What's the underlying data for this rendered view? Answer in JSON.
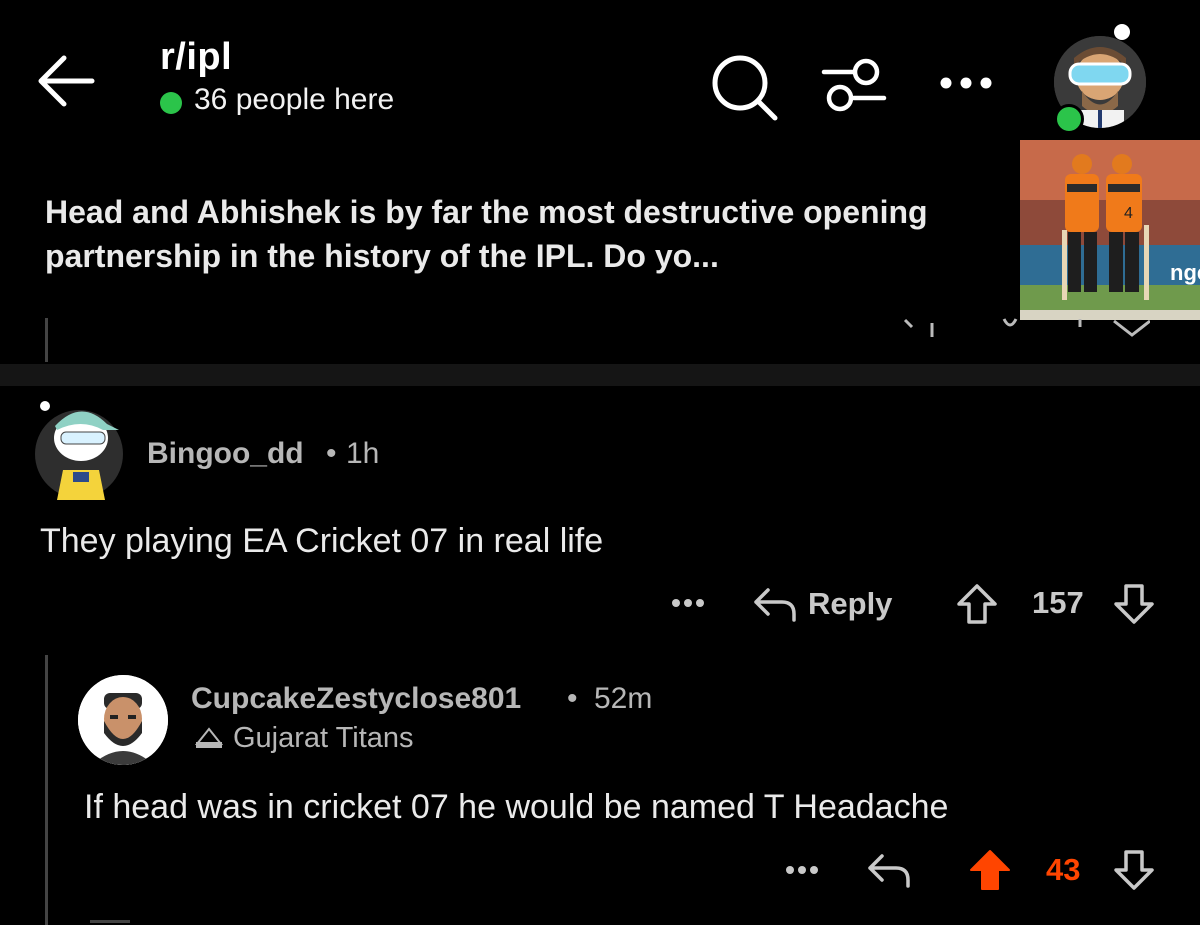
{
  "header": {
    "subreddit": "r/ipl",
    "online_text": "36 people here",
    "icons": [
      "back-arrow-icon",
      "search-icon",
      "filter-icon",
      "more-icon",
      "avatar"
    ]
  },
  "post": {
    "title": "Head and Abhishek is by far the most destructive opening partnership in the history of the IPL. Do yo..."
  },
  "comments": [
    {
      "user": "Bingoo_dd",
      "separator": "•",
      "time": "1h",
      "body": "They playing EA Cricket 07 in real life",
      "reply_label": "Reply",
      "score": "157"
    },
    {
      "user": "CupcakeZestyclose801",
      "separator": "•",
      "time": "52m",
      "flair": "Gujarat Titans",
      "body": "If head was in cricket 07 he would be named T Headache",
      "score": "43",
      "upvoted": true
    }
  ],
  "colors": {
    "background": "#000000",
    "online": "#2bc44a",
    "upvote": "#ff4500",
    "muted": "#b7b7b7",
    "divider": "#151515"
  }
}
